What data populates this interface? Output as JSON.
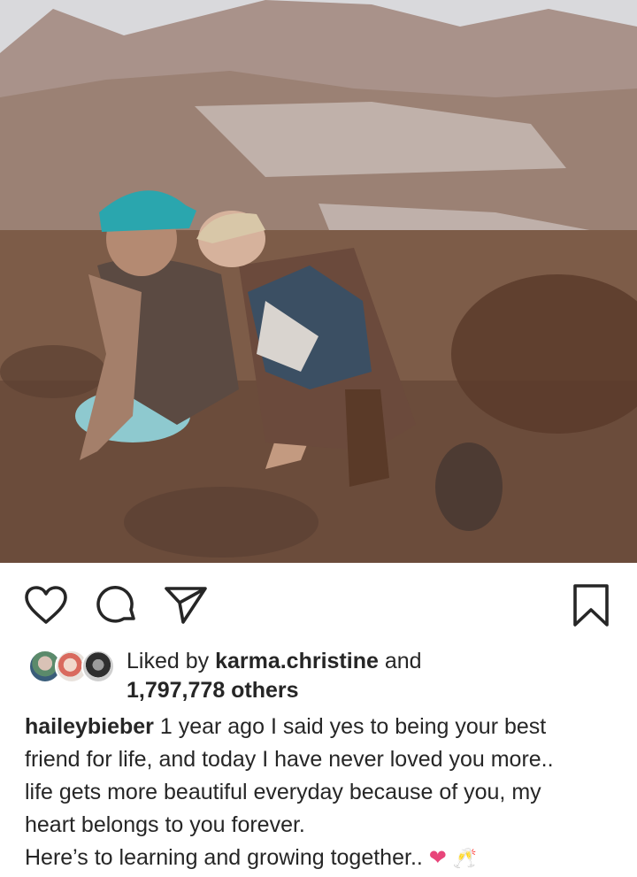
{
  "post": {
    "image_alt": "Couple sitting together in a desert landscape"
  },
  "actions": {
    "like_icon": "heart-outline-icon",
    "comment_icon": "comment-bubble-icon",
    "share_icon": "paper-plane-icon",
    "save_icon": "bookmark-icon"
  },
  "likes": {
    "prefix": "Liked by ",
    "user": "karma.christine",
    "suffix": " and",
    "others": "1,797,778 others"
  },
  "caption": {
    "username": "haileybieber",
    "line1": " 1 year ago I said yes to being your best",
    "line2": "friend for life, and today I have never loved you more..",
    "line3": "life gets more beautiful everyday because of you, my",
    "line4": "heart belongs to you forever.",
    "line5": " Here’s to learning and growing together.. ",
    "heart": "❤",
    "glasses": "🥂"
  },
  "colors": {
    "text": "#262626",
    "heart": "#e8457a"
  }
}
